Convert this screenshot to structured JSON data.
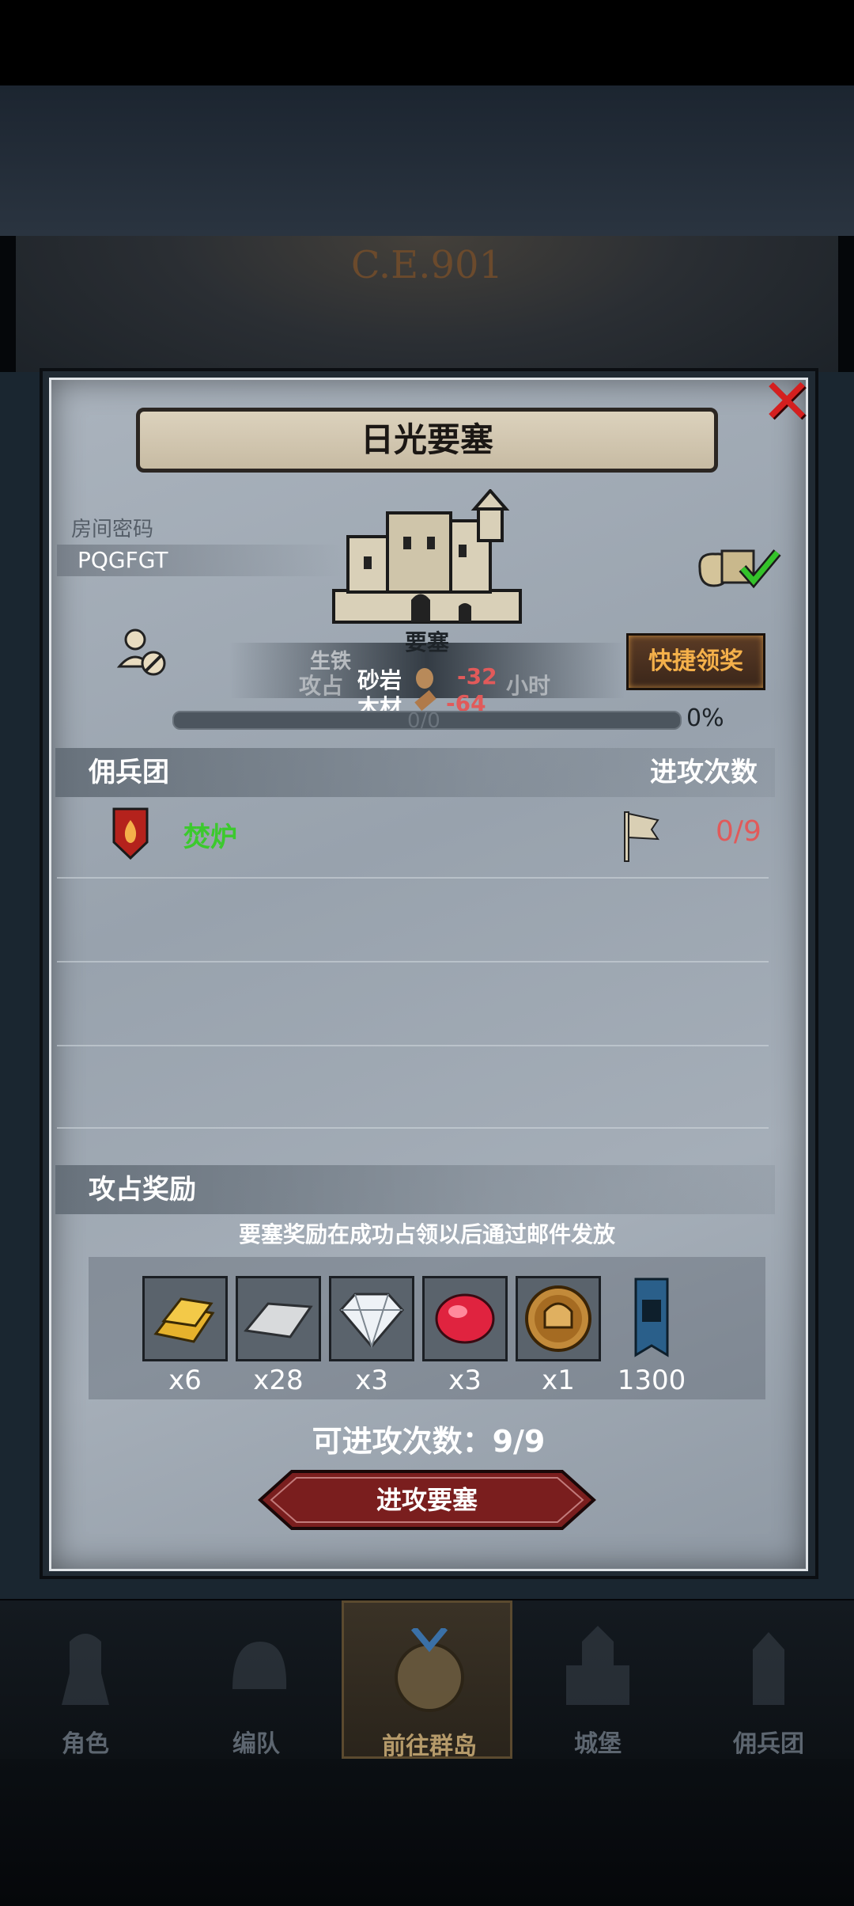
{
  "header": {
    "era": "C.E.901"
  },
  "dialog": {
    "title": "日光要塞",
    "room_code_label": "房间密码",
    "room_code": "PQGFGT",
    "fortress_label": "要塞",
    "overlay_texts": [
      "生铁",
      "砂岩",
      "攻占",
      "小时"
    ],
    "resource_sandstone_label": "砂岩",
    "resource_sandstone_value": "-32",
    "resource_wood_label": "木材",
    "resource_wood_value": "-64",
    "quick_claim_label": "快捷领奖",
    "progress_text": "0/0",
    "progress_percent": "0%",
    "progress_value": 0
  },
  "mercenary": {
    "section_title": "佣兵团",
    "attack_count_title": "进攻次数",
    "items": [
      {
        "name": "焚炉",
        "attacks": "0/9"
      }
    ]
  },
  "rewards": {
    "section_title": "攻占奖励",
    "note": "要塞奖励在成功占领以后通过邮件发放",
    "items": [
      {
        "icon": "gold-bars-icon",
        "qty": "x6"
      },
      {
        "icon": "iron-ingot-icon",
        "qty": "x28"
      },
      {
        "icon": "diamond-icon",
        "qty": "x3"
      },
      {
        "icon": "ruby-icon",
        "qty": "x3"
      },
      {
        "icon": "knight-helmet-coin-icon",
        "qty": "x1"
      },
      {
        "icon": "fortress-banner-icon",
        "qty": "1300"
      }
    ]
  },
  "attack": {
    "available_label": "可进攻次数：9/9",
    "attack_button": "进攻要塞"
  },
  "nav": {
    "items": [
      {
        "label": "角色"
      },
      {
        "label": "编队"
      },
      {
        "label": "前往群岛"
      },
      {
        "label": "城堡"
      },
      {
        "label": "佣兵团"
      }
    ]
  },
  "colors": {
    "accent_red": "#e15a5a",
    "mercenary_green": "#3cc92e",
    "quick_gold": "#f4b04a"
  }
}
